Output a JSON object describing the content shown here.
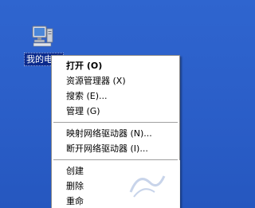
{
  "desktop": {
    "background_color": "#2a5fc8",
    "icon": {
      "name": "my-computer",
      "icon": "computer-icon",
      "label": "我的电脑"
    }
  },
  "context_menu": {
    "items": [
      {
        "label": "打开 (O)",
        "bold": true
      },
      {
        "label": "资源管理器 (X)"
      },
      {
        "label": "搜索 (E)..."
      },
      {
        "label": "管理 (G)"
      },
      {
        "label": "映射网络驱动器 (N)..."
      },
      {
        "label": "断开网络驱动器 (I)..."
      },
      {
        "label": "创建"
      },
      {
        "label": "删除"
      },
      {
        "label": "重命"
      }
    ]
  }
}
